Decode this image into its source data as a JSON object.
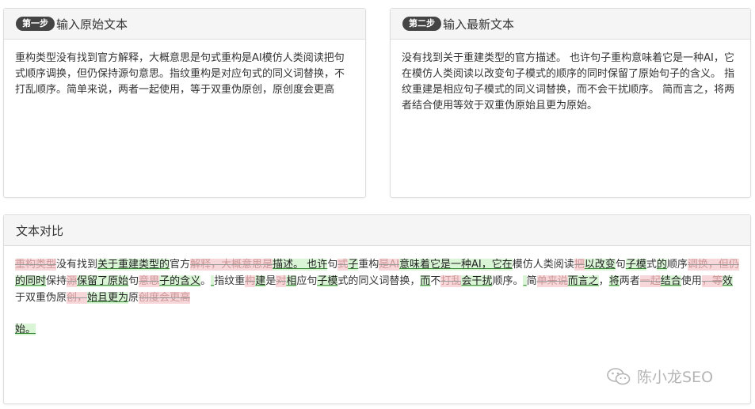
{
  "step1": {
    "badge": "第一步",
    "title": "输入原始文本",
    "text": "重构类型没有找到官方解释，大概意思是句式重构是AI模仿人类阅读把句式顺序调换，但仍保持源句意思。指纹重构是对应句式的同义词替换，不打乱顺序。简单来说，两者一起使用，等于双重伪原创，原创度会更高"
  },
  "step2": {
    "badge": "第二步",
    "title": "输入最新文本",
    "text": "没有找到关于重建类型的官方描述。 也许句子重构意味着它是一种AI，它在模仿人类阅读以改变句子模式的顺序的同时保留了原始句子的含义。 指纹重建是相应句子模式的同义词替换，而不会干扰顺序。 简而言之，将两者结合使用等效于双重伪原始且更为原始。"
  },
  "compare": {
    "title": "文本对比",
    "segments": [
      {
        "t": "重构类型",
        "k": "del"
      },
      {
        "t": "没有找到",
        "k": "same"
      },
      {
        "t": "关于重建类型的",
        "k": "ins"
      },
      {
        "t": "官方",
        "k": "same"
      },
      {
        "t": "解释，大概意思是",
        "k": "del"
      },
      {
        "t": "描述。 也许",
        "k": "ins"
      },
      {
        "t": "句",
        "k": "same"
      },
      {
        "t": "式",
        "k": "del"
      },
      {
        "t": "子",
        "k": "ins"
      },
      {
        "t": "重构",
        "k": "same"
      },
      {
        "t": "是AI",
        "k": "del"
      },
      {
        "t": "意味着它是一种AI，它在",
        "k": "ins"
      },
      {
        "t": "模仿人类阅读",
        "k": "same"
      },
      {
        "t": "把",
        "k": "del"
      },
      {
        "t": "以改变",
        "k": "ins"
      },
      {
        "t": "句",
        "k": "same"
      },
      {
        "t": "子模",
        "k": "ins"
      },
      {
        "t": "式",
        "k": "same"
      },
      {
        "t": "的",
        "k": "ins"
      },
      {
        "t": "顺序",
        "k": "same"
      },
      {
        "t": "调换，但仍",
        "k": "del"
      },
      {
        "t": "的同时",
        "k": "ins"
      },
      {
        "t": "保持",
        "k": "same"
      },
      {
        "t": "源",
        "k": "del"
      },
      {
        "t": "保留了原始",
        "k": "ins"
      },
      {
        "t": "句",
        "k": "same"
      },
      {
        "t": "意思",
        "k": "del"
      },
      {
        "t": "子的含义",
        "k": "ins"
      },
      {
        "t": "。",
        "k": "same"
      },
      {
        "t": " ",
        "k": "ins"
      },
      {
        "t": "指纹重",
        "k": "same"
      },
      {
        "t": "构",
        "k": "del"
      },
      {
        "t": "建",
        "k": "ins"
      },
      {
        "t": "是",
        "k": "same"
      },
      {
        "t": "对",
        "k": "del"
      },
      {
        "t": "相",
        "k": "ins"
      },
      {
        "t": "应句",
        "k": "same"
      },
      {
        "t": "子模",
        "k": "ins"
      },
      {
        "t": "式的同义词替换，",
        "k": "same"
      },
      {
        "t": "而",
        "k": "ins"
      },
      {
        "t": "不",
        "k": "same"
      },
      {
        "t": "打乱",
        "k": "del"
      },
      {
        "t": "会干扰",
        "k": "ins"
      },
      {
        "t": "顺序。",
        "k": "same"
      },
      {
        "t": " ",
        "k": "ins"
      },
      {
        "t": "简",
        "k": "same"
      },
      {
        "t": "单来说",
        "k": "del"
      },
      {
        "t": "而言之",
        "k": "ins"
      },
      {
        "t": "，",
        "k": "same"
      },
      {
        "t": "将",
        "k": "ins"
      },
      {
        "t": "两者",
        "k": "same"
      },
      {
        "t": "一起",
        "k": "del"
      },
      {
        "t": "结合",
        "k": "ins"
      },
      {
        "t": "使用",
        "k": "same"
      },
      {
        "t": "，等",
        "k": "del"
      },
      {
        "t": "效",
        "k": "ins"
      },
      {
        "t": "于双重伪原",
        "k": "same"
      },
      {
        "t": "创，",
        "k": "del"
      },
      {
        "t": "始且更为",
        "k": "ins"
      },
      {
        "t": "原",
        "k": "same"
      },
      {
        "t": "创度会更高",
        "k": "del"
      }
    ],
    "last_line": "始。"
  },
  "watermark": {
    "text": "陈小龙SEO",
    "icon": "wechat-icon"
  },
  "colors": {
    "insert_bg": "#d9f5d6",
    "delete_bg": "#f8d7da",
    "header_bg": "#f5f5f5",
    "badge_bg": "#444444"
  }
}
